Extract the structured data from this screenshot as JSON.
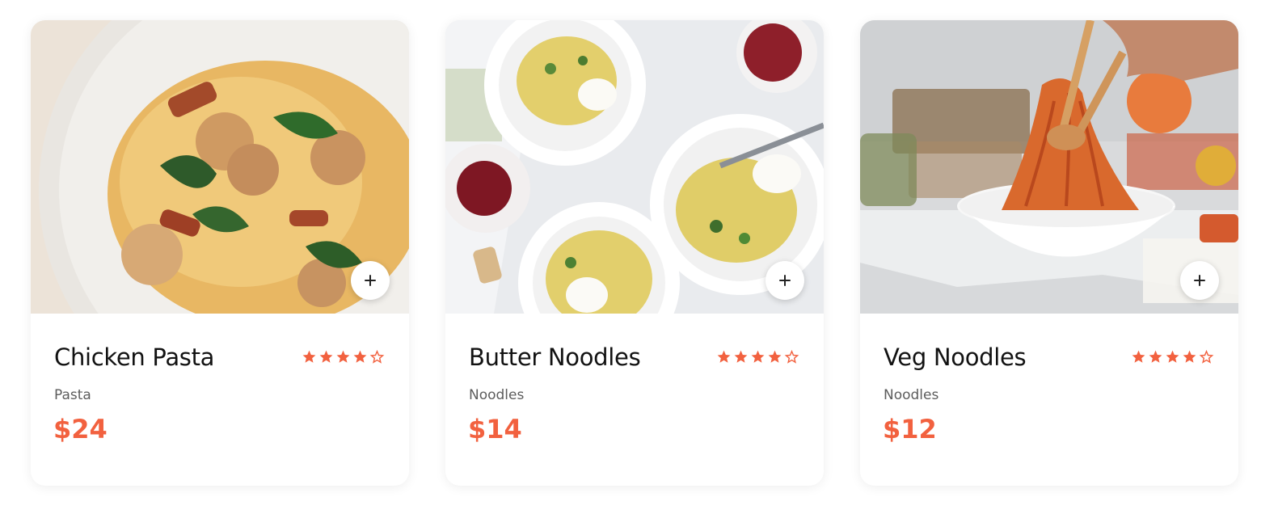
{
  "accent_color": "#f2613f",
  "cards": [
    {
      "name": "Chicken Pasta",
      "category": "Pasta",
      "price": "$24",
      "rating": 4,
      "rating_max": 5,
      "image_icon": "chicken-pasta-photo",
      "add_icon": "plus-icon"
    },
    {
      "name": "Butter Noodles",
      "category": "Noodles",
      "price": "$14",
      "rating": 4,
      "rating_max": 5,
      "image_icon": "butter-noodles-photo",
      "add_icon": "plus-icon"
    },
    {
      "name": "Veg Noodles",
      "category": "Noodles",
      "price": "$12",
      "rating": 4,
      "rating_max": 5,
      "image_icon": "veg-noodles-photo",
      "add_icon": "plus-icon"
    }
  ]
}
